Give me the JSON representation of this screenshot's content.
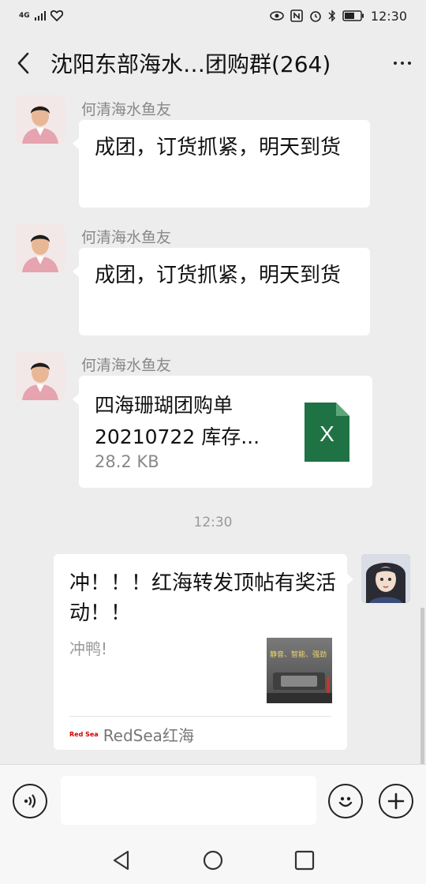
{
  "status_bar": {
    "network": "4G",
    "time": "12:30"
  },
  "header": {
    "title": "沈阳东部海水…团购群(264)"
  },
  "messages": [
    {
      "sender": "何清海水鱼友",
      "text": "成团，订货抓紧，明天到货"
    },
    {
      "sender": "何清海水鱼友",
      "text": "成团，订货抓紧，明天到货"
    },
    {
      "sender": "何清海水鱼友",
      "file_name": "四海珊瑚团购单20210722 库存...",
      "file_size": "28.2 KB",
      "file_type_letter": "X"
    }
  ],
  "timestamp": "12:30",
  "card": {
    "title": "冲！！！红海转发顶帖有奖活动！！",
    "description": "冲鸭!",
    "thumb_text": "静音、智能、强劲",
    "source": "RedSea红海",
    "source_logo": "Red Sea"
  },
  "input": {
    "placeholder": ""
  },
  "colors": {
    "background": "#ededed",
    "bubble": "#ffffff",
    "excel_green": "#1f7244"
  }
}
